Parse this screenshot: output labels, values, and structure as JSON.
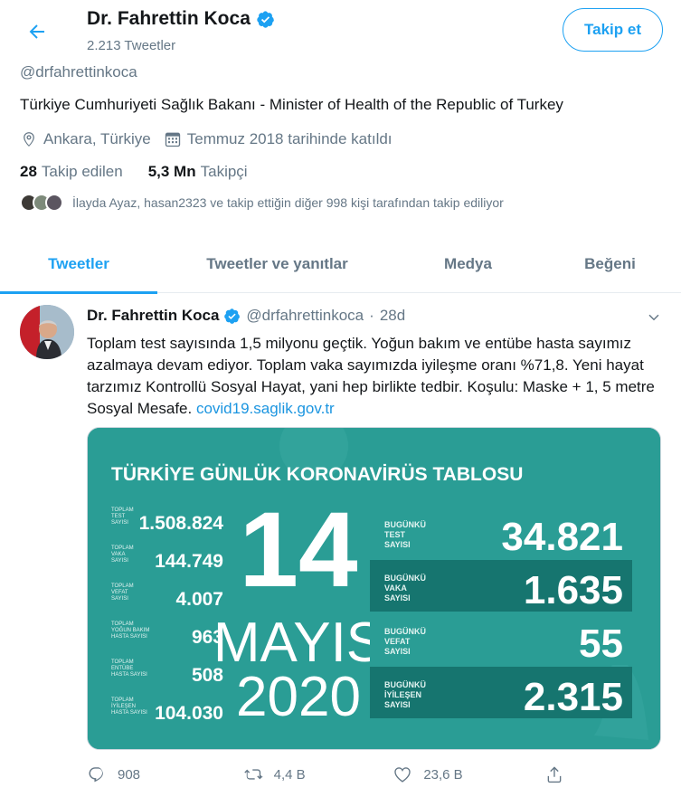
{
  "header": {
    "name": "Dr. Fahrettin Koca",
    "tweet_count": "2.213 Tweetler",
    "follow_label": "Takip et"
  },
  "profile": {
    "handle": "@drfahrettinkoca",
    "bio": "Türkiye Cumhuriyeti Sağlık Bakanı - Minister of Health of the Republic of Turkey",
    "location": "Ankara, Türkiye",
    "joined": "Temmuz 2018 tarihinde katıldı",
    "following_count": "28",
    "following_label": "Takip edilen",
    "followers_count": "5,3 Mn",
    "followers_label": "Takipçi",
    "followed_by": "İlayda Ayaz, hasan2323 ve takip ettiğin diğer 998 kişi tarafından takip ediliyor"
  },
  "tabs": [
    {
      "label": "Tweetler",
      "active": true
    },
    {
      "label": "Tweetler ve yanıtlar",
      "active": false
    },
    {
      "label": "Medya",
      "active": false
    },
    {
      "label": "Beğeni",
      "active": false
    }
  ],
  "tweet": {
    "name": "Dr. Fahrettin Koca",
    "handle": "@drfahrettinkoca",
    "separator": "·",
    "time": "28d",
    "text": "Toplam test sayısında 1,5 milyonu geçtik. Yoğun bakım ve entübe hasta sayımız azalmaya devam ediyor. Toplam vaka sayımızda iyileşme oranı %71,8. Yeni hayat tarzımız Kontrollü Sosyal Hayat, yani hep birlikte tedbir. Koşulu: Maske + 1, 5 metre Sosyal Mesafe. ",
    "link": "covid19.saglik.gov.tr",
    "replies": "908",
    "retweets": "4,4 B",
    "likes": "23,6 B"
  },
  "media": {
    "title": "TÜRKİYE GÜNLÜK KORONAVİRÜS TABLOSU",
    "day": "14",
    "month": "MAYIS",
    "year": "2020",
    "totals": [
      {
        "label": [
          "TOPLAM",
          "TEST",
          "SAYISI"
        ],
        "value": "1.508.824"
      },
      {
        "label": [
          "TOPLAM",
          "VAKA",
          "SAYISI"
        ],
        "value": "144.749"
      },
      {
        "label": [
          "TOPLAM",
          "VEFAT",
          "SAYISI"
        ],
        "value": "4.007"
      },
      {
        "label": [
          "TOPLAM",
          "YOĞUN BAKIM",
          "HASTA SAYISI"
        ],
        "value": "963"
      },
      {
        "label": [
          "TOPLAM",
          "ENTÜBE",
          "HASTA SAYISI"
        ],
        "value": "508"
      },
      {
        "label": [
          "TOPLAM",
          "İYİLEŞEN",
          "HASTA SAYISI"
        ],
        "value": "104.030"
      }
    ],
    "daily": [
      {
        "label": [
          "BUGÜNKÜ",
          "TEST",
          "SAYISI"
        ],
        "value": "34.821"
      },
      {
        "label": [
          "BUGÜNKÜ",
          "VAKA",
          "SAYISI"
        ],
        "value": "1.635"
      },
      {
        "label": [
          "BUGÜNKÜ",
          "VEFAT",
          "SAYISI"
        ],
        "value": "55"
      },
      {
        "label": [
          "BUGÜNKÜ",
          "İYİLEŞEN",
          "SAYISI"
        ],
        "value": "2.315"
      }
    ]
  },
  "colors": {
    "accent": "#1da1f2",
    "teal": "#2a9d95",
    "teal_dark": "#16756f"
  },
  "icons": {
    "back": "arrow-left-icon",
    "verified": "verified-badge-icon",
    "location": "location-pin-icon",
    "calendar": "calendar-icon",
    "chevron": "chevron-down-icon",
    "reply": "reply-icon",
    "retweet": "retweet-icon",
    "like": "heart-icon",
    "share": "share-icon"
  }
}
